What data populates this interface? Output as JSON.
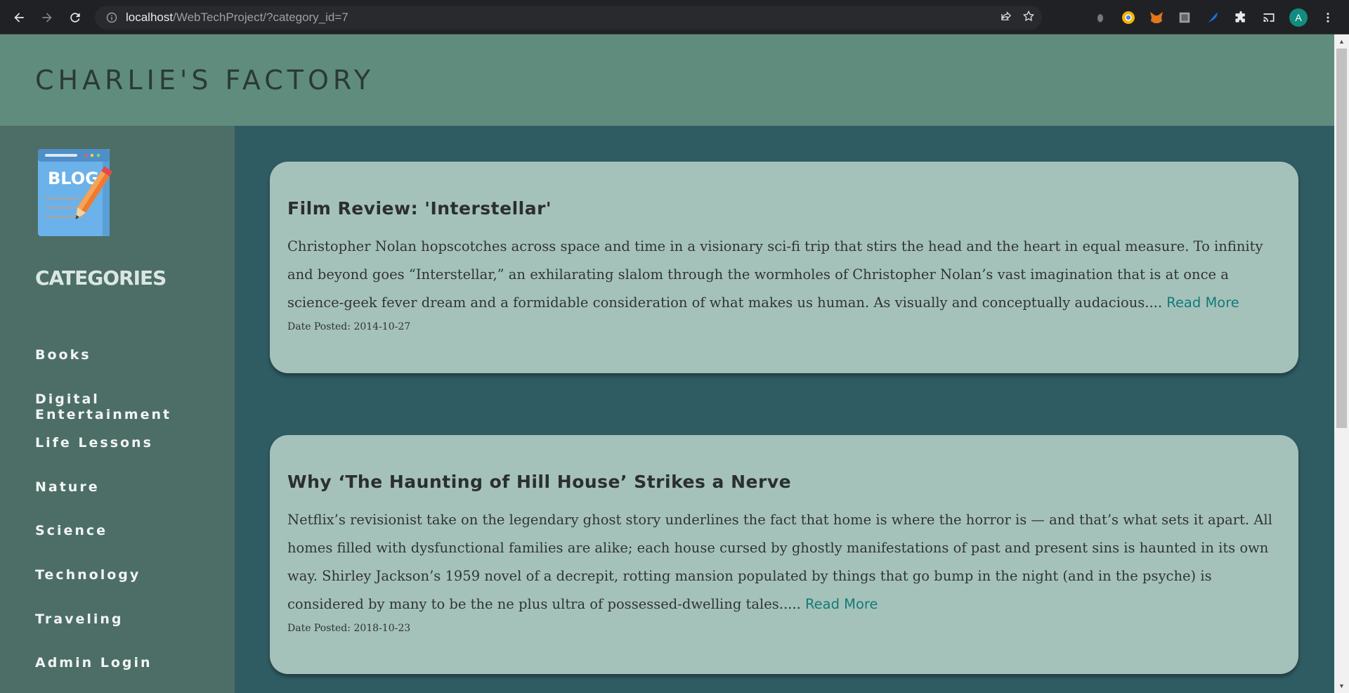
{
  "browser": {
    "url_host": "localhost",
    "url_path": "/WebTechProject/?category_id=7",
    "profile_initial": "A"
  },
  "site": {
    "title": "CHARLIE'S FACTORY"
  },
  "sidebar": {
    "logo_text": "BLOG",
    "heading": "CATEGORIES",
    "items": [
      {
        "label": "Books"
      },
      {
        "label": "Digital Entertainment"
      },
      {
        "label": "Life Lessons"
      },
      {
        "label": "Nature"
      },
      {
        "label": "Science"
      },
      {
        "label": "Technology"
      },
      {
        "label": "Traveling"
      },
      {
        "label": "Admin Login"
      }
    ]
  },
  "posts": [
    {
      "title": "Film Review: 'Interstellar'",
      "excerpt": "Christopher Nolan hopscotches across space and time in a visionary sci-fi trip that stirs the head and the heart in equal measure. To infinity and beyond goes “Interstellar,” an exhilarating slalom through the wormholes of Christopher Nolan’s vast imagination that is at once a science-geek fever dream and a formidable consideration of what makes us human. As visually and conceptually audacious....",
      "read_more": "Read More",
      "date": "Date Posted: 2014-10-27"
    },
    {
      "title": "Why ‘The Haunting of Hill House’ Strikes a Nerve",
      "excerpt": "Netflix’s revisionist take on the legendary ghost story underlines the fact that home is where the horror is — and that’s what sets it apart. All homes filled with dysfunctional families are alike; each house cursed by ghostly manifestations of past and present sins is haunted in its own way. Shirley Jackson’s 1959 novel of a decrepit, rotting mansion populated by things that go bump in the night (and in the psyche) is considered by many to be the ne plus ultra of possessed-dwelling tales.....",
      "read_more": "Read More",
      "date": "Date Posted: 2018-10-23"
    }
  ],
  "colors": {
    "header_bg": "#608c7e",
    "sidebar_bg": "#4c6e66",
    "content_bg": "#2f5c63",
    "card_bg": "#a5c2ba",
    "link": "#147a78"
  }
}
